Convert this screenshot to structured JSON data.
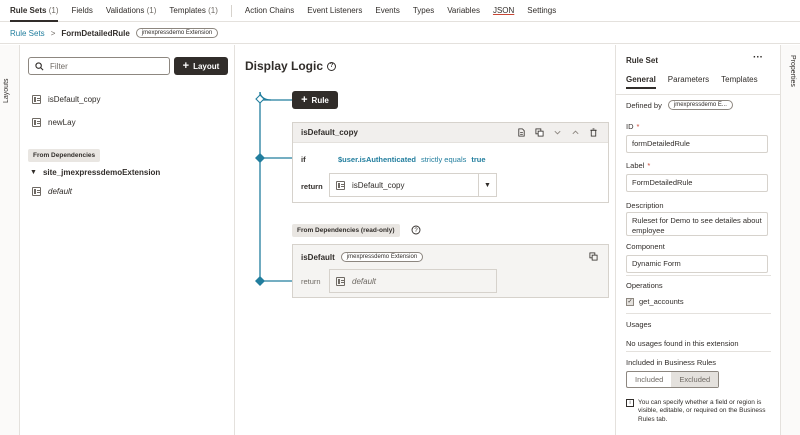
{
  "topnav": {
    "tabs": [
      {
        "label": "Rule Sets",
        "count": "(1)"
      },
      {
        "label": "Fields"
      },
      {
        "label": "Validations",
        "count": "(1)"
      },
      {
        "label": "Templates",
        "count": "(1)"
      },
      {
        "label": "Action Chains"
      },
      {
        "label": "Event Listeners"
      },
      {
        "label": "Events"
      },
      {
        "label": "Types"
      },
      {
        "label": "Variables"
      },
      {
        "label": "JSON"
      },
      {
        "label": "Settings"
      }
    ]
  },
  "breadcrumb": {
    "root": "Rule Sets",
    "current": "FormDetailedRule",
    "badge": "jmexpressdemo Extension"
  },
  "left_rail": {
    "label": "Layouts"
  },
  "right_rail": {
    "label": "Properties"
  },
  "leftpanel": {
    "filter_placeholder": "Filter",
    "layout_button": "Layout",
    "items": [
      {
        "label": "isDefault_copy"
      },
      {
        "label": "newLay"
      }
    ],
    "dependencies_header": "From Dependencies",
    "dependency_folder": "site_jmexpressdemoExtension",
    "dependency_items": [
      {
        "label": "default"
      }
    ]
  },
  "canvas": {
    "title": "Display Logic",
    "rule_button": "Rule",
    "card1": {
      "title": "isDefault_copy",
      "if_keyword": "if",
      "condition_var": "$user.isAuthenticated",
      "condition_op": "strictly equals",
      "condition_val": "true",
      "return_keyword": "return",
      "return_value": "isDefault_copy"
    },
    "readonly_header": "From Dependencies (read-only)",
    "card2": {
      "title": "isDefault",
      "badge": "jmexpressdemo Extension",
      "return_keyword": "return",
      "return_value": "default"
    }
  },
  "rightpanel": {
    "title": "Rule Set",
    "tabs": [
      "General",
      "Parameters",
      "Templates"
    ],
    "defined_by_label": "Defined by",
    "defined_by_badge": "jmexpressdemo E...",
    "id_label": "ID",
    "id_value": "formDetailedRule",
    "label_label": "Label",
    "label_value": "FormDetailedRule",
    "description_label": "Description",
    "description_value": "Ruleset for Demo to see detailes about employee",
    "component_label": "Component",
    "component_value": "Dynamic Form",
    "operations_label": "Operations",
    "operation_item": "get_accounts",
    "usages_label": "Usages",
    "usages_value": "No usages found in this extension",
    "business_rules_label": "Included in Business Rules",
    "included": "Included",
    "excluded": "Excluded",
    "note": "You can specify whether a field or region is visible, editable, or required on the Business Rules tab."
  }
}
